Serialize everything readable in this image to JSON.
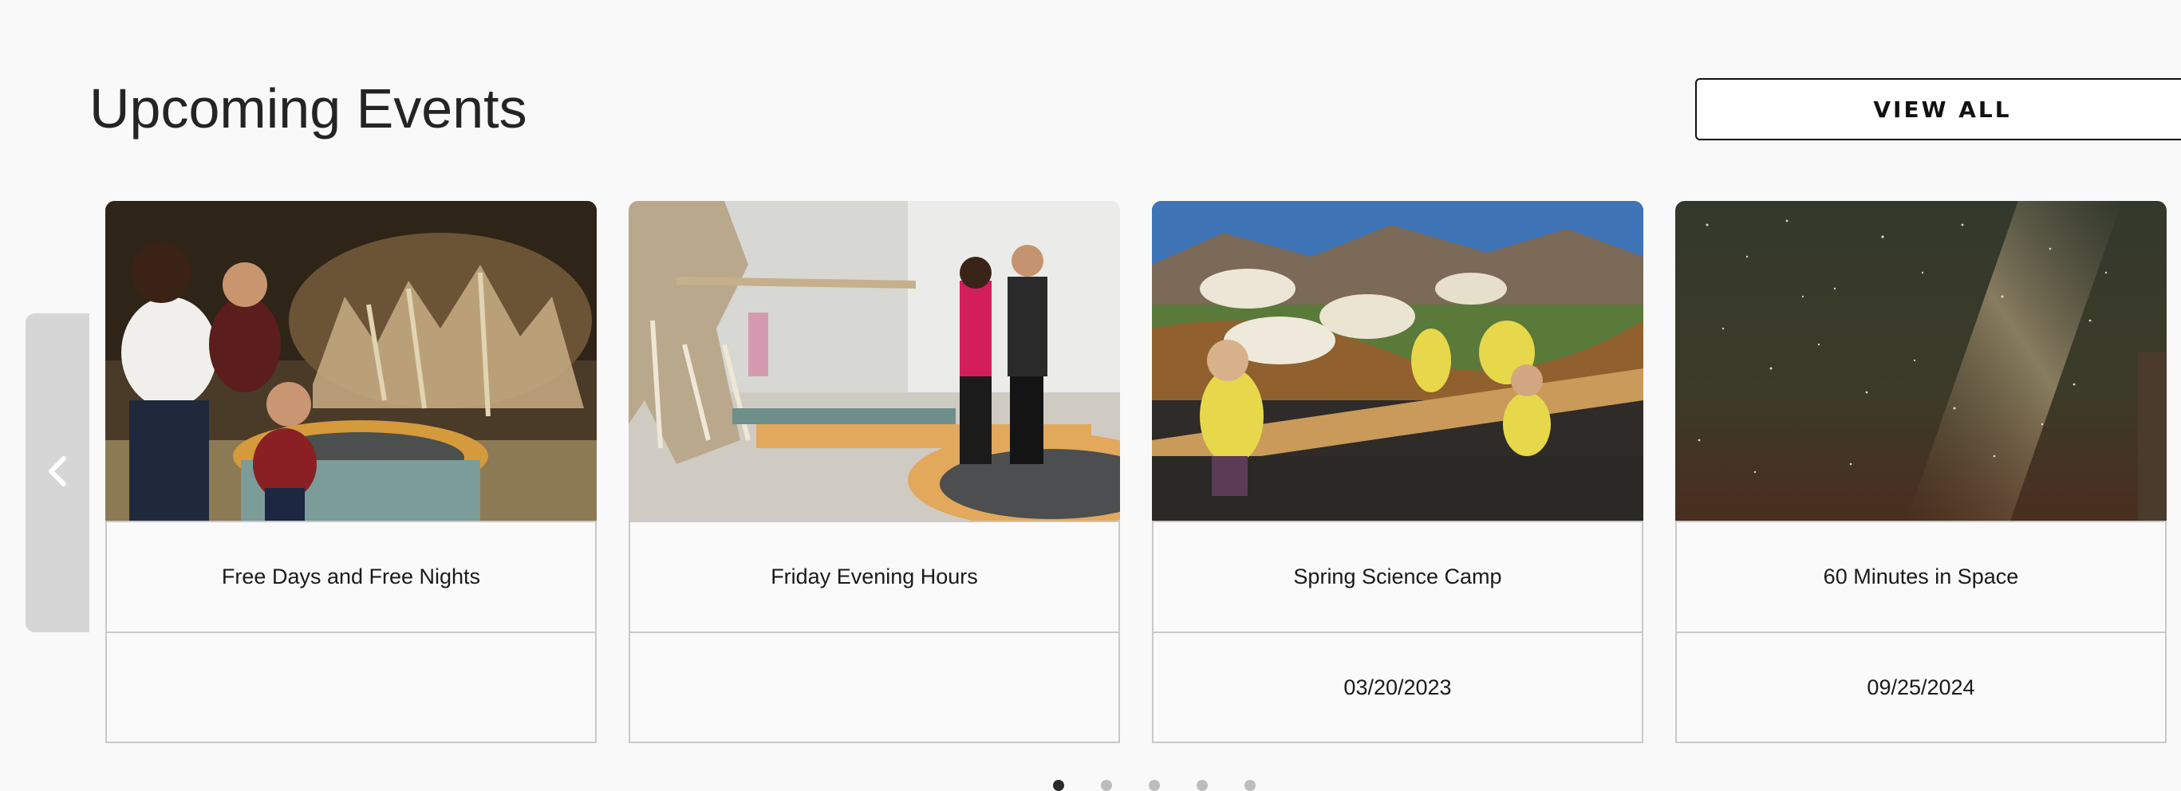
{
  "section": {
    "title": "Upcoming Events",
    "view_all_label": "VIEW ALL"
  },
  "carousel": {
    "prev_icon": "chevron-left-icon",
    "active_page": 1,
    "page_count": 5
  },
  "events": [
    {
      "title": "Free Days and Free Nights",
      "date": ""
    },
    {
      "title": "Friday Evening Hours",
      "date": ""
    },
    {
      "title": "Spring Science Camp",
      "date": "03/20/2023"
    },
    {
      "title": "60 Minutes in Space",
      "date": "09/25/2024"
    }
  ],
  "colors": {
    "background": "#f9f9f9",
    "border": "#c9c9c9",
    "arrow_panel": "#d6d6d6",
    "dot_active": "#2a2a2a",
    "dot_inactive": "#bdbdbd"
  }
}
